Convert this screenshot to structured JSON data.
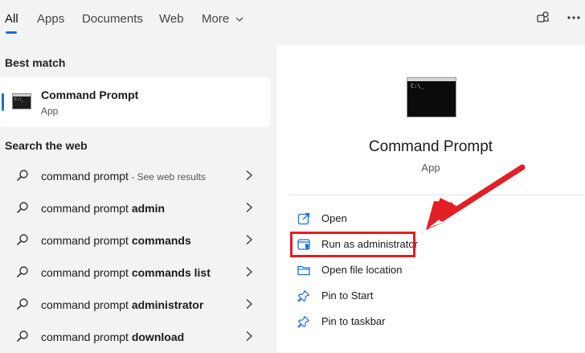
{
  "tabs": [
    {
      "label": "All",
      "active": true
    },
    {
      "label": "Apps"
    },
    {
      "label": "Documents"
    },
    {
      "label": "Web"
    },
    {
      "label": "More"
    }
  ],
  "icons": {
    "more_chevron": "chevron-down-icon",
    "account": "share-switch-icon",
    "menu": "ellipsis-icon",
    "search": "search-icon",
    "chevron_right": "chevron-right-icon"
  },
  "best_match": {
    "heading": "Best match",
    "title": "Command Prompt",
    "subtitle": "App"
  },
  "search_web": {
    "heading": "Search the web",
    "items": [
      {
        "plain": "command prompt",
        "bold": "",
        "hint": " - See web results"
      },
      {
        "plain": "command prompt ",
        "bold": "admin",
        "hint": ""
      },
      {
        "plain": "command prompt ",
        "bold": "commands",
        "hint": ""
      },
      {
        "plain": "command prompt ",
        "bold": "commands list",
        "hint": ""
      },
      {
        "plain": "command prompt ",
        "bold": "administrator",
        "hint": ""
      },
      {
        "plain": "command prompt ",
        "bold": "download",
        "hint": ""
      }
    ]
  },
  "detail": {
    "title": "Command Prompt",
    "subtitle": "App",
    "console_glyph": "C:\\_",
    "actions": [
      {
        "label": "Open",
        "icon": "open-external-icon"
      },
      {
        "label": "Run as administrator",
        "icon": "shield-icon"
      },
      {
        "label": "Open file location",
        "icon": "folder-icon"
      },
      {
        "label": "Pin to Start",
        "icon": "pin-icon"
      },
      {
        "label": "Pin to taskbar",
        "icon": "pin-icon"
      }
    ]
  },
  "colors": {
    "accent": "#1a6ed8",
    "annotation_red": "#e21e26",
    "panel_bg": "#ffffff",
    "page_bg": "#f3f3f3"
  }
}
